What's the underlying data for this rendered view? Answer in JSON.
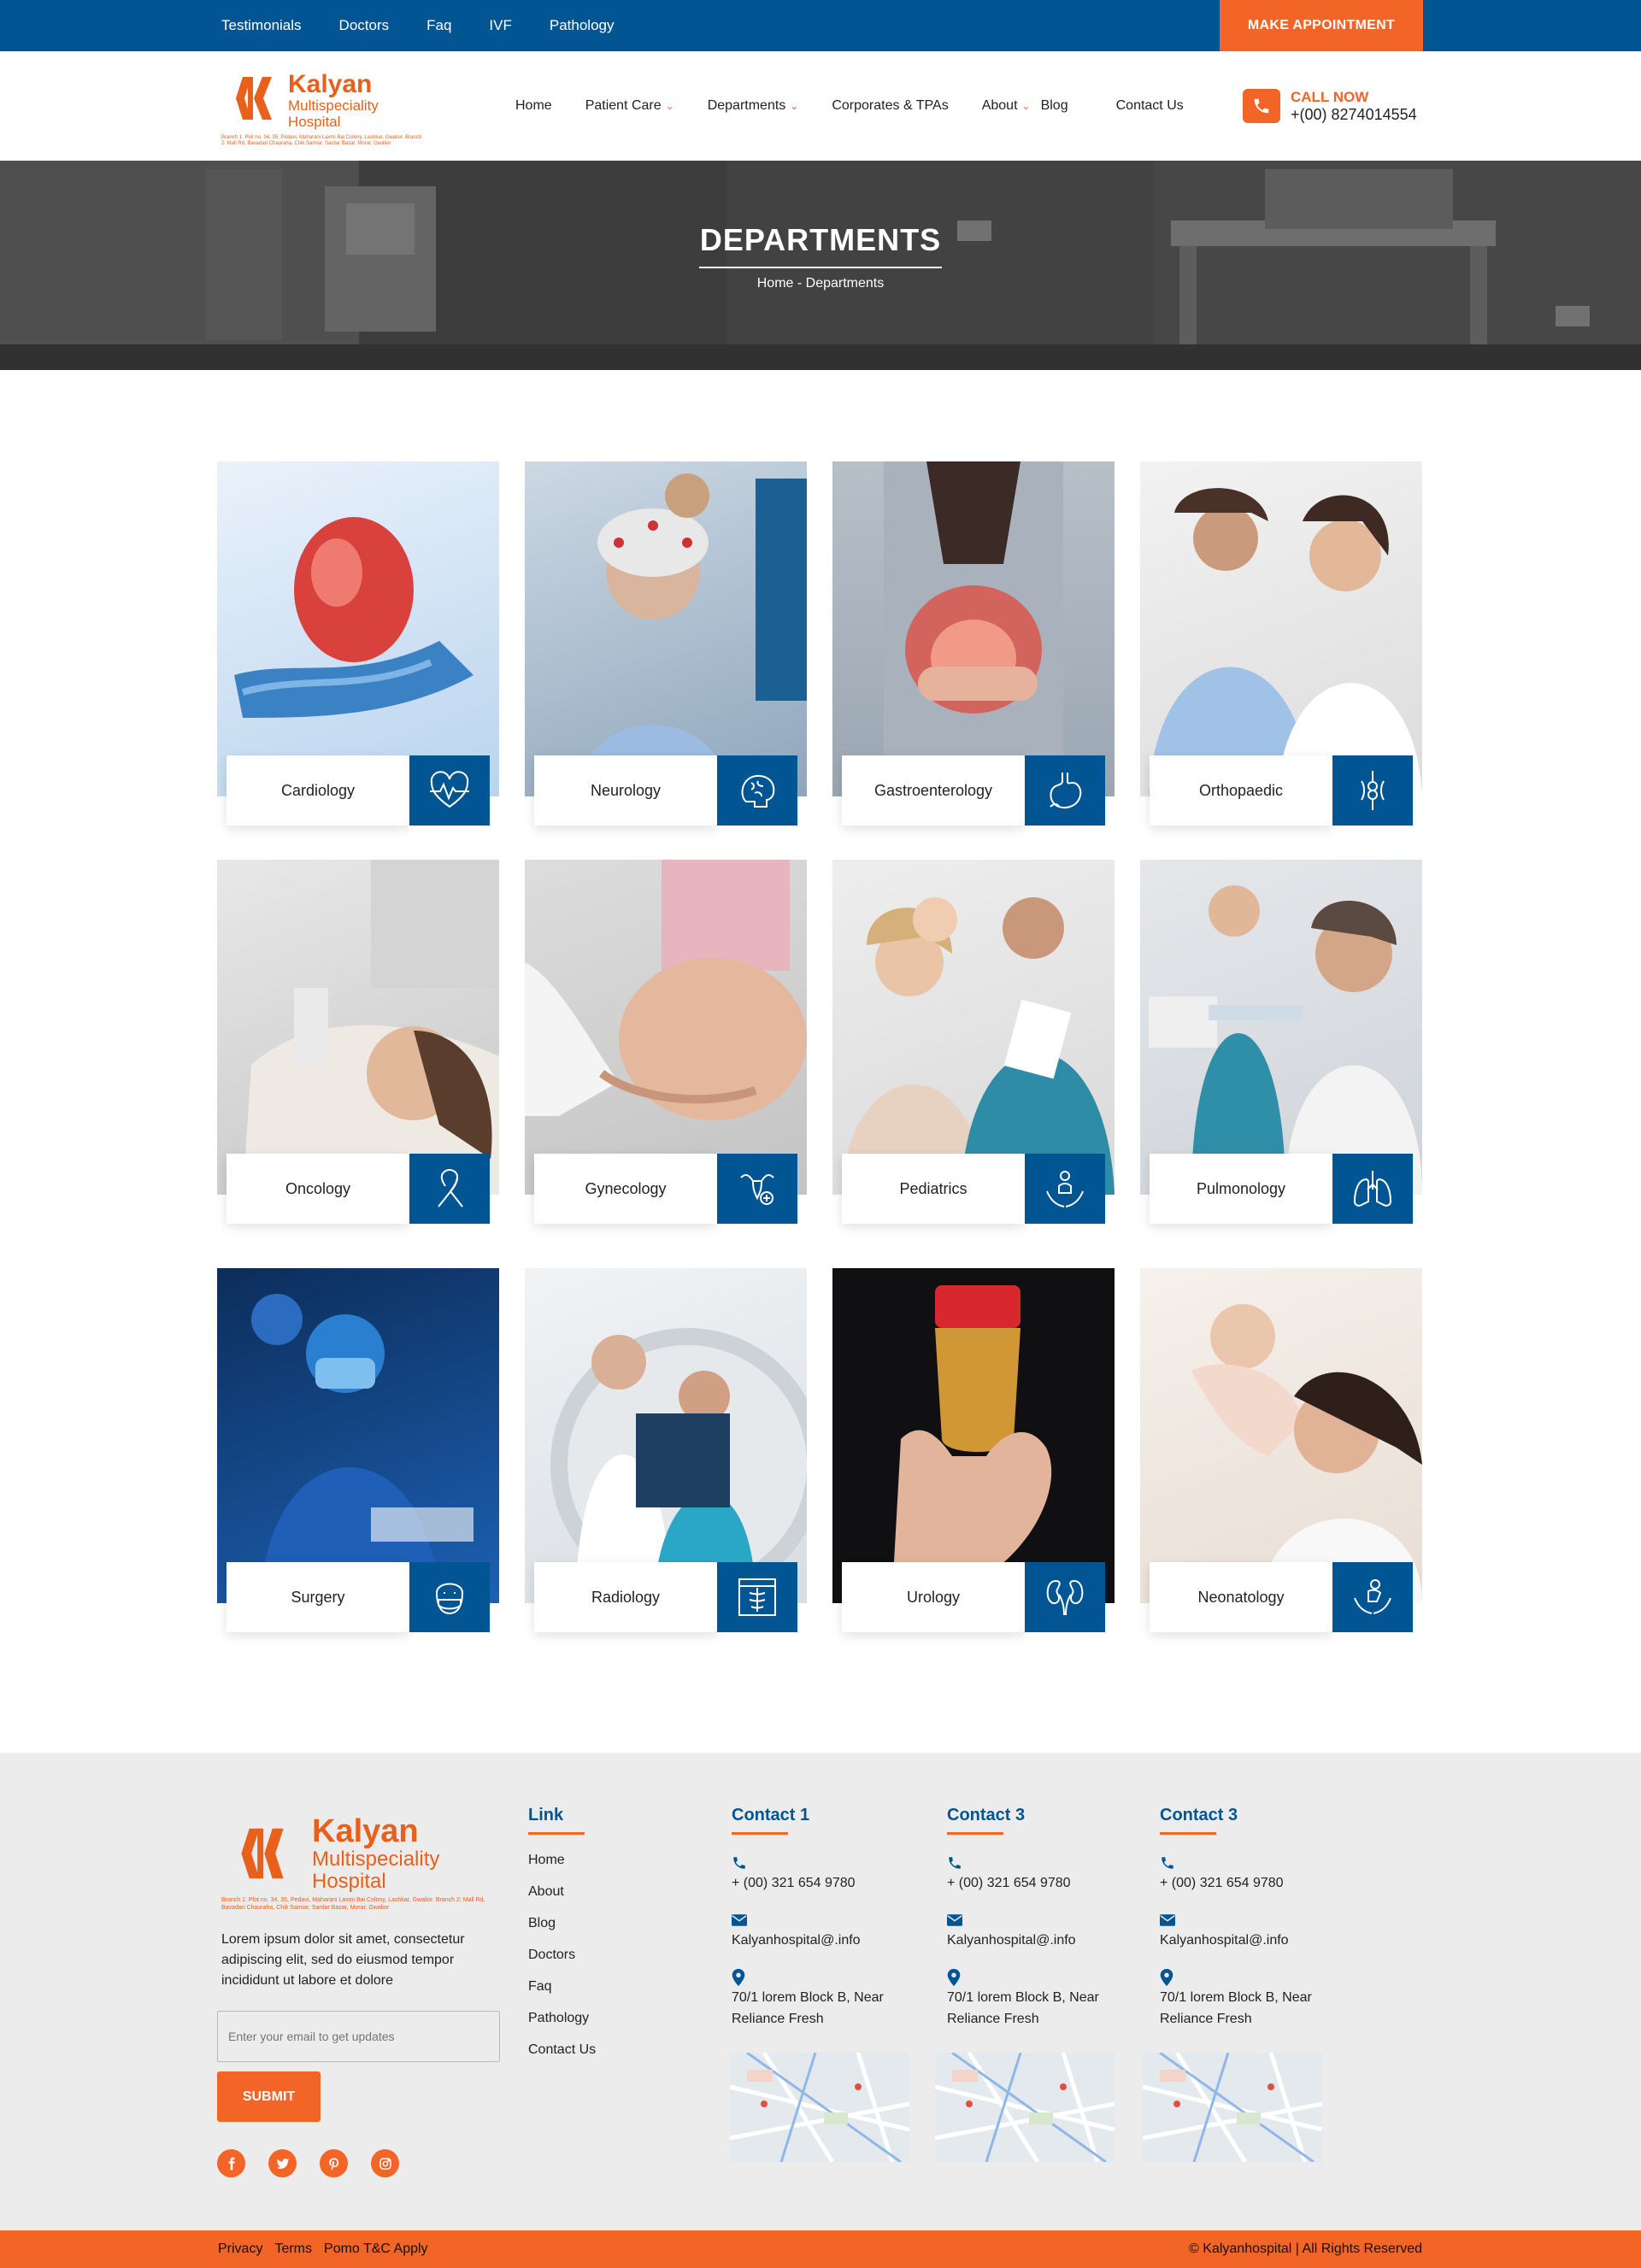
{
  "topbar": {
    "links": [
      "Testimonials",
      "Doctors",
      "Faq",
      "IVF",
      "Pathology"
    ],
    "appointment_label": "MAKE APPOINTMENT"
  },
  "header": {
    "logo_name": "Kalyan",
    "logo_sub1": "Multispeciality",
    "logo_sub2": "Hospital",
    "logo_address": "Branch 1: Plot no. 34, 35, Pedavi, Maharani Laxmi Bai Colony, Lashkar, Gwalior. Branch 2: Mall Rd, Bavadari Chauraha, Chik Samiar, Sardar Bazar, Morar, Gwalior",
    "nav": [
      {
        "label": "Home",
        "has_dropdown": false
      },
      {
        "label": "Patient Care",
        "has_dropdown": true
      },
      {
        "label": "Departments",
        "has_dropdown": true
      },
      {
        "label": "Corporates & TPAs",
        "has_dropdown": false
      },
      {
        "label": "About",
        "has_dropdown": true
      },
      {
        "label": "Blog",
        "has_dropdown": false
      },
      {
        "label": "Contact Us",
        "has_dropdown": false
      }
    ],
    "call_label": "CALL NOW",
    "call_number": "+(00) 8274014554"
  },
  "hero": {
    "title": "DEPARTMENTS",
    "breadcrumb": "Home - Departments"
  },
  "departments": [
    {
      "name": "Cardiology",
      "icon": "heart-pulse-icon"
    },
    {
      "name": "Neurology",
      "icon": "brain-icon"
    },
    {
      "name": "Gastroenterology",
      "icon": "stomach-icon"
    },
    {
      "name": "Orthopaedic",
      "icon": "bone-joint-icon"
    },
    {
      "name": "Oncology",
      "icon": "ribbon-icon"
    },
    {
      "name": "Gynecology",
      "icon": "uterus-icon"
    },
    {
      "name": "Pediatrics",
      "icon": "child-care-icon"
    },
    {
      "name": "Pulmonology",
      "icon": "lungs-icon"
    },
    {
      "name": "Surgery",
      "icon": "surgeon-icon"
    },
    {
      "name": "Radiology",
      "icon": "xray-icon"
    },
    {
      "name": "Urology",
      "icon": "kidney-icon"
    },
    {
      "name": "Neonatology",
      "icon": "baby-hands-icon"
    }
  ],
  "footer": {
    "description": "Lorem ipsum dolor sit amet, consectetur adipiscing elit, sed do eiusmod tempor incididunt ut labore et dolore",
    "email_placeholder": "Enter your email to get updates",
    "submit_label": "SUBMIT",
    "social": [
      "facebook-icon",
      "twitter-icon",
      "pinterest-icon",
      "instagram-icon"
    ],
    "links_heading": "Link",
    "links": [
      "Home",
      "About",
      "Blog",
      "Doctors",
      "Faq",
      "Pathology",
      "Contact Us"
    ],
    "contacts": [
      {
        "heading": "Contact 1",
        "phone": "+ (00) 321 654 9780",
        "email": "Kalyanhospital@.info",
        "address1": "70/1 lorem Block B, Near",
        "address2": "Reliance Fresh"
      },
      {
        "heading": "Contact 3",
        "phone": "+ (00) 321 654 9780",
        "email": "Kalyanhospital@.info",
        "address1": "70/1 lorem Block B, Near",
        "address2": "Reliance Fresh"
      },
      {
        "heading": "Contact 3",
        "phone": "+ (00) 321 654 9780",
        "email": "Kalyanhospital@.info",
        "address1": "70/1 lorem Block B, Near",
        "address2": "Reliance Fresh"
      }
    ]
  },
  "bottombar": {
    "links": [
      "Privacy",
      "Terms",
      "Pomo T&C Apply"
    ],
    "copyright": "© Kalyanhospital | All Rights Reserved"
  },
  "colors": {
    "primary": "#005592",
    "accent": "#f26526",
    "footer_bg": "#ececec"
  }
}
